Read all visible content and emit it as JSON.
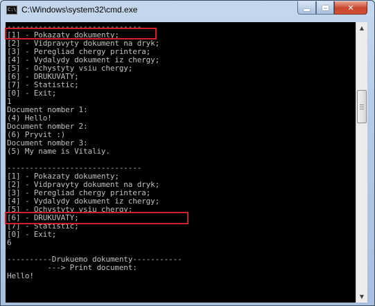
{
  "window": {
    "title": "C:\\Windows\\system32\\cmd.exe",
    "icon_text": "C:\\",
    "icon": "console-window-icon",
    "controls": {
      "minimize": "minimize-icon",
      "maximize": "maximize-icon",
      "close": "✕"
    }
  },
  "console": {
    "text_color": "#c0c0c0",
    "background": "#000000",
    "lines": [
      "------------------------------",
      "[1] - Pokazaty dokumenty;",
      "[2] - Vidpravyty dokument na dryk;",
      "[3] - Peregliad chergy printera;",
      "[4] - Vydalydy dokument iz chergy;",
      "[5] - Ochystyty vsiu chergy;",
      "[6] - DRUKUVATY;",
      "[7] - Statistic;",
      "[0] - Exit;",
      "1",
      "Document nomber 1:",
      "(4) Hello!",
      "Document nomber 2:",
      "(6) Pryvit :)",
      "Document nomber 3:",
      "(5) My name is Vitaliy.",
      "",
      "------------------------------",
      "[1] - Pokazaty dokumenty;",
      "[2] - Vidpravyty dokument na dryk;",
      "[3] - Peregliad chergy printera;",
      "[4] - Vydalydy dokument iz chergy;",
      "[5] - Ochystyty vsiu chergy;",
      "[6] - DRUKUVATY;",
      "[7] - Statistic;",
      "[0] - Exit;",
      "6",
      "",
      "----------Drukuemo dokumenty-----------",
      "         ---> Print document:",
      "Hello!"
    ]
  },
  "annotations": {
    "highlight_color": "#d0202a"
  },
  "scrollbar": {
    "up_arrow": "▲",
    "down_arrow": "▼"
  }
}
